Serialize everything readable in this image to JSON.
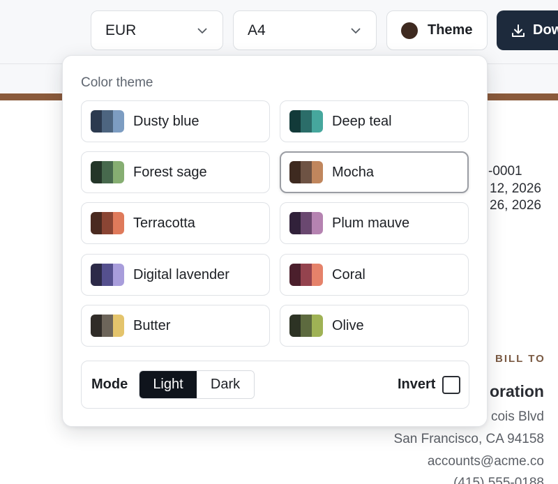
{
  "toolbar": {
    "currency": "EUR",
    "paper_size": "A4",
    "theme_label": "Theme",
    "download_label": "Dow"
  },
  "document": {
    "lines": [
      "-0001",
      "12, 2026",
      "26, 2026"
    ],
    "bill_to": "BILL TO",
    "company_fragment": "oration",
    "address_fragment": "cois Blvd",
    "city": "San Francisco, CA 94158",
    "email": "accounts@acme.co",
    "phone": "(415) 555-0188"
  },
  "popover": {
    "title": "Color theme",
    "themes": [
      {
        "label": "Dusty blue",
        "colors": [
          "#2c3a4f",
          "#4d6580",
          "#7d9dc2"
        ]
      },
      {
        "label": "Deep teal",
        "colors": [
          "#123a39",
          "#2b6d69",
          "#46a79d"
        ]
      },
      {
        "label": "Forest sage",
        "colors": [
          "#243629",
          "#47694d",
          "#86ae72"
        ]
      },
      {
        "label": "Mocha",
        "colors": [
          "#3e2a20",
          "#6e5344",
          "#c0865d"
        ]
      },
      {
        "label": "Terracotta",
        "colors": [
          "#4a2a20",
          "#8a4534",
          "#df7a5b"
        ]
      },
      {
        "label": "Plum mauve",
        "colors": [
          "#31213a",
          "#6a4870",
          "#b583b1"
        ]
      },
      {
        "label": "Digital lavender",
        "colors": [
          "#2c2a48",
          "#55508e",
          "#a89ddb"
        ]
      },
      {
        "label": "Coral",
        "colors": [
          "#4b1f2c",
          "#94434e",
          "#e5826a"
        ]
      },
      {
        "label": "Butter",
        "colors": [
          "#302c28",
          "#6d655a",
          "#e4c46c"
        ]
      },
      {
        "label": "Olive",
        "colors": [
          "#2d3324",
          "#5d6a3f",
          "#9fb255"
        ]
      }
    ],
    "selected_theme": "Mocha",
    "mode": {
      "label": "Mode",
      "options": [
        "Light",
        "Dark"
      ],
      "selected": "Light"
    },
    "invert": {
      "label": "Invert",
      "checked": false
    }
  }
}
